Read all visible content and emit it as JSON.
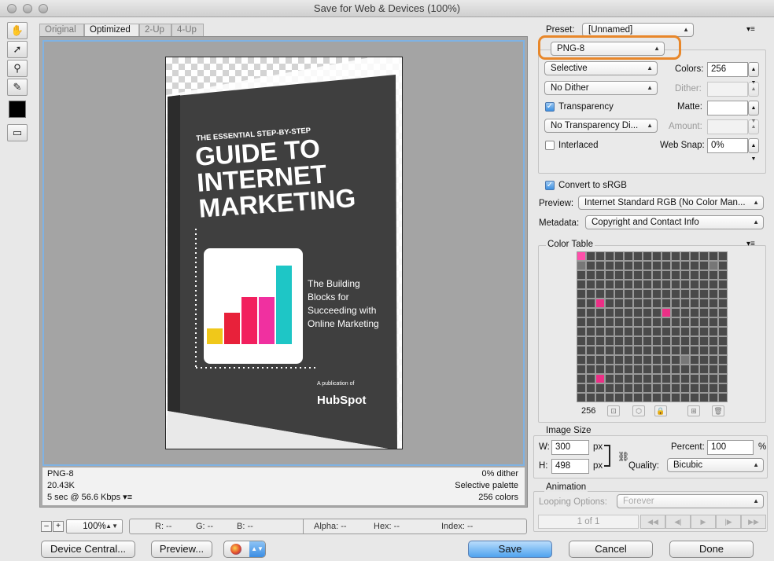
{
  "window": {
    "title": "Save for Web & Devices (100%)"
  },
  "view_tabs": [
    "Original",
    "Optimized",
    "2-Up",
    "4-Up"
  ],
  "cover": {
    "kicker": "THE ESSENTIAL STEP-BY-STEP",
    "title_lines": [
      "GUIDE TO",
      "INTERNET",
      "MARKETING"
    ],
    "subtitle_lines": [
      "The Building",
      "Blocks for",
      "Succeeding with",
      "Online Marketing"
    ],
    "publication": "A publication of",
    "brand": "HubSpot"
  },
  "info": {
    "format": "PNG-8",
    "size": "20.43K",
    "download": "5 sec @ 56.6 Kbps",
    "dither": "0% dither",
    "palette": "Selective palette",
    "colors": "256 colors"
  },
  "zoom": {
    "minus": "–",
    "plus": "+",
    "value": "100%"
  },
  "readout": {
    "r": "R: --",
    "g": "G: --",
    "b": "B: --",
    "alpha": "Alpha: --",
    "hex": "Hex: --",
    "index": "Index: --"
  },
  "buttons": {
    "device_central": "Device Central...",
    "preview": "Preview...",
    "save": "Save",
    "cancel": "Cancel",
    "done": "Done"
  },
  "settings": {
    "preset_label": "Preset:",
    "preset_value": "[Unnamed]",
    "format": "PNG-8",
    "reduction": "Selective",
    "colors_label": "Colors:",
    "colors_value": "256",
    "dither_algo": "No Dither",
    "dither_label": "Dither:",
    "transparency_label": "Transparency",
    "matte_label": "Matte:",
    "transparency_dither": "No Transparency Di...",
    "amount_label": "Amount:",
    "interlaced_label": "Interlaced",
    "websnap_label": "Web Snap:",
    "websnap_value": "0%",
    "convert_label": "Convert to sRGB",
    "preview_label": "Preview:",
    "preview_value": "Internet Standard RGB (No Color Man...",
    "metadata_label": "Metadata:",
    "metadata_value": "Copyright and Contact Info",
    "highlight_color": "#e8872a"
  },
  "color_table": {
    "title": "Color Table",
    "count": "256",
    "palette": [
      "#4a4a4a",
      "#5a5a5a",
      "#d2d2d2",
      "#f24aa0",
      "#e9e9e9",
      "#3a3a3a",
      "#2ec8c8",
      "#eeeeee",
      "#555555",
      "#e74c8b",
      "#ffffff",
      "#ff2ea0",
      "#cfcfcf",
      "#5e5e5e",
      "#f6b8c8",
      "#f0c81a",
      "#f4f4f4",
      "#c9c9c9",
      "#00c4c8",
      "#e83050",
      "#ff4faa",
      "#ffffff",
      "#666666",
      "#d8d8d8",
      "#777777",
      "#ec2f86",
      "#ffffff",
      "#f0aabd",
      "#ffffff",
      "#2a2a2a",
      "#dedede",
      "#fa3d82"
    ]
  },
  "image_size": {
    "title": "Image Size",
    "w_label": "W:",
    "w_value": "300",
    "w_unit": "px",
    "h_label": "H:",
    "h_value": "498",
    "h_unit": "px",
    "percent_label": "Percent:",
    "percent_value": "100",
    "percent_unit": "%",
    "quality_label": "Quality:",
    "quality_value": "Bicubic"
  },
  "animation": {
    "title": "Animation",
    "looping_label": "Looping Options:",
    "looping_value": "Forever",
    "frame": "1 of 1"
  }
}
